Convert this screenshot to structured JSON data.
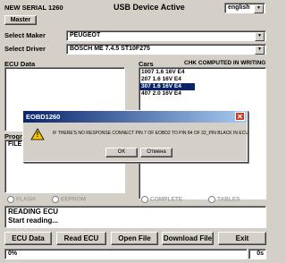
{
  "header": {
    "serial": "NEW SERIAL 1260",
    "status": "USB Device Active",
    "language": "english"
  },
  "master_button": "Master",
  "select_maker": {
    "label": "Select Maker",
    "value": "PEUGEOT"
  },
  "select_driver": {
    "label": "Select Driver",
    "value": "BOSCH ME 7.4.5 ST10F275"
  },
  "ecu_data": {
    "label": "ECU Data"
  },
  "cars": {
    "label": "Cars",
    "chk_note": "CHK COMPUTED IN WRITING",
    "items": [
      {
        "text": "1007 1.6 16V E4",
        "selected": false
      },
      {
        "text": "207 1.6 16V E4",
        "selected": false
      },
      {
        "text": "307 1.6 16V E4",
        "selected": true
      },
      {
        "text": "407 2.0 16V E4",
        "selected": false
      }
    ]
  },
  "progress_section": {
    "label": "Progr",
    "file_label": "FILE"
  },
  "radios": {
    "flash": "FLASH",
    "eeprom": "EEPROM",
    "complete": "COMPLETE",
    "tables": "TABLES"
  },
  "log": {
    "line1": "READING ECU",
    "line2": "Start reading..."
  },
  "buttons": {
    "ecu_data": "ECU Data",
    "read_ecu": "Read ECU",
    "open_file": "Open File",
    "download_file": "Download File",
    "exit": "Exit"
  },
  "statusbar": {
    "percent": "0%",
    "seconds": "0s"
  },
  "dialog": {
    "title": "EOBD1260",
    "message": "IF THERE'S NO RESPONSE CONNECT PIN 7 OF EOBD2 TO PIN 84 OF 32_PIN BLACK IN ECU",
    "ok": "OK",
    "cancel": "Отмена",
    "close_glyph": "✕",
    "warning_glyph": "!"
  },
  "colors": {
    "selection": "#0a246a",
    "dialog_close": "#c43b1d",
    "warning": "#f5c400"
  }
}
